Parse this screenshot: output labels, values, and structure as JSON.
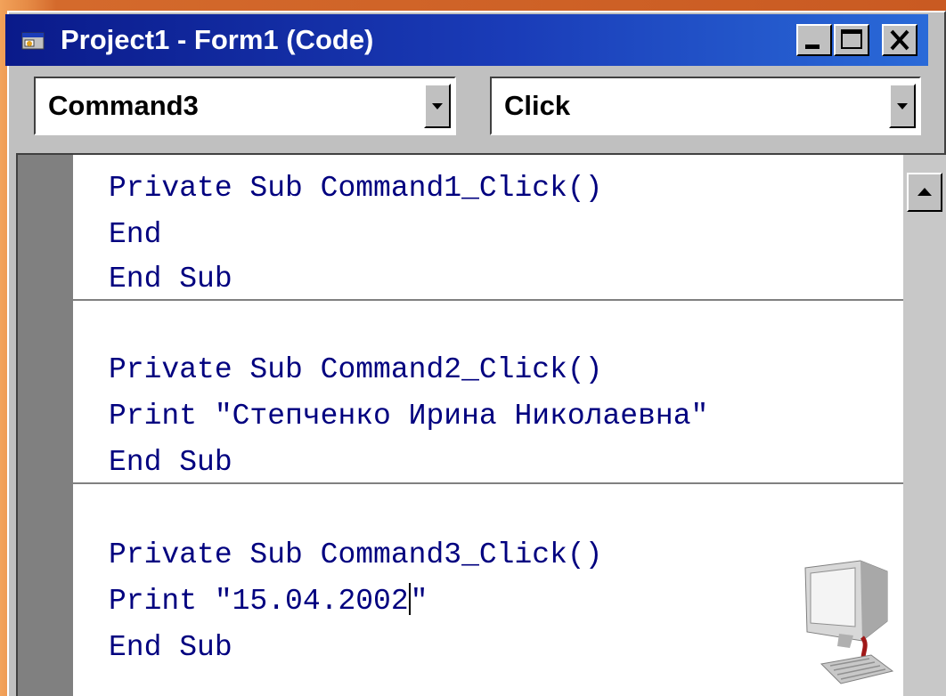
{
  "window": {
    "title": "Project1 - Form1 (Code)",
    "icons": {
      "app": "vb-form-icon",
      "minimize": "minimize-icon",
      "maximize": "maximize-icon",
      "close": "close-icon"
    }
  },
  "toolbar": {
    "object_combo_value": "Command3",
    "procedure_combo_value": "Click"
  },
  "code": {
    "procedures": [
      {
        "lines": [
          "Private Sub Command1_Click()",
          "End",
          "End Sub"
        ]
      },
      {
        "lines": [
          "Private Sub Command2_Click()",
          "Print \"Степченко Ирина Николаевна\"",
          "End Sub"
        ]
      },
      {
        "lines": [
          "Private Sub Command3_Click()",
          "Print \"15.04.2002",
          "End Sub"
        ],
        "caret_suffix": "\""
      }
    ]
  },
  "colors": {
    "title_bar_start": "#0a1a8a",
    "title_bar_end": "#2a6ad8",
    "code_text": "#00007f",
    "chrome": "#c0c0c0",
    "slide_background": "#c95a22"
  },
  "decoration": {
    "clipart": "computer-icon"
  }
}
